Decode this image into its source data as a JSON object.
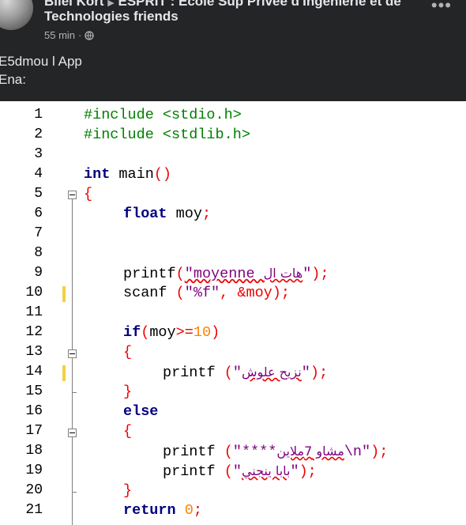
{
  "post": {
    "author": "Bilel Kort",
    "group": "ESPRIT : Ecole Sup Privée d'Ingénierie et de",
    "group_line2": "Technologies friends",
    "time": "55 min",
    "audience_icon": "globe-icon",
    "more_icon": "more-options-icon",
    "more_label": "•••",
    "text_line1": "E5dmou l App",
    "text_line2": "Ena:"
  },
  "editor": {
    "line_numbers": [
      "1",
      "2",
      "3",
      "4",
      "5",
      "6",
      "7",
      "8",
      "9",
      "10",
      "11",
      "12",
      "13",
      "14",
      "15",
      "16",
      "17",
      "18",
      "19",
      "20",
      "21"
    ],
    "code": {
      "l1_directive": "#include <stdio.h>",
      "l2_directive": "#include <stdlib.h>",
      "l4_kw": "int",
      "l4_rest": " main",
      "l4_paren": "()",
      "l5_brace": "{",
      "l6_kw": "float",
      "l6_rest": " moy",
      "l6_semi": ";",
      "l9_fn": "printf",
      "l9_open": "(",
      "l9_str_start": "\"moyenne ",
      "l9_ar": "هات ال",
      "l9_str_end": "\"",
      "l9_close": ");",
      "l10_fn": "scanf",
      "l10_open": " (",
      "l10_str": "\"%f\"",
      "l10_mid": ", &moy",
      "l10_close": ");",
      "l12_kw": "if",
      "l12_open": "(",
      "l12_var": "moy",
      "l12_op": ">=",
      "l12_num": "10",
      "l12_close": ")",
      "l13_brace": "{",
      "l14_fn": "printf",
      "l14_open": " (",
      "l14_q1": "\"",
      "l14_ar": "نزيح علوش",
      "l14_q2": "\"",
      "l14_close": ");",
      "l15_brace": "}",
      "l16_kw": "else",
      "l17_brace": "{",
      "l18_fn": "printf",
      "l18_open": " (",
      "l18_str_start": "\"****",
      "l18_ar": "مشاو 7ملاين",
      "l18_str_end": "\\n\"",
      "l18_close": ");",
      "l19_fn": "printf",
      "l19_open": " (",
      "l19_q1": "\"",
      "l19_ar": "بابا ينجني",
      "l19_q2": "\"",
      "l19_close": ");",
      "l20_brace": "}",
      "l21_kw": "return",
      "l21_num": " 0",
      "l21_semi": ";"
    },
    "colors": {
      "keyword": "#00007f",
      "preprocessor": "#007f00",
      "number": "#ff8000",
      "string": "#7f007f",
      "change_marker": "#f4d03f"
    }
  }
}
